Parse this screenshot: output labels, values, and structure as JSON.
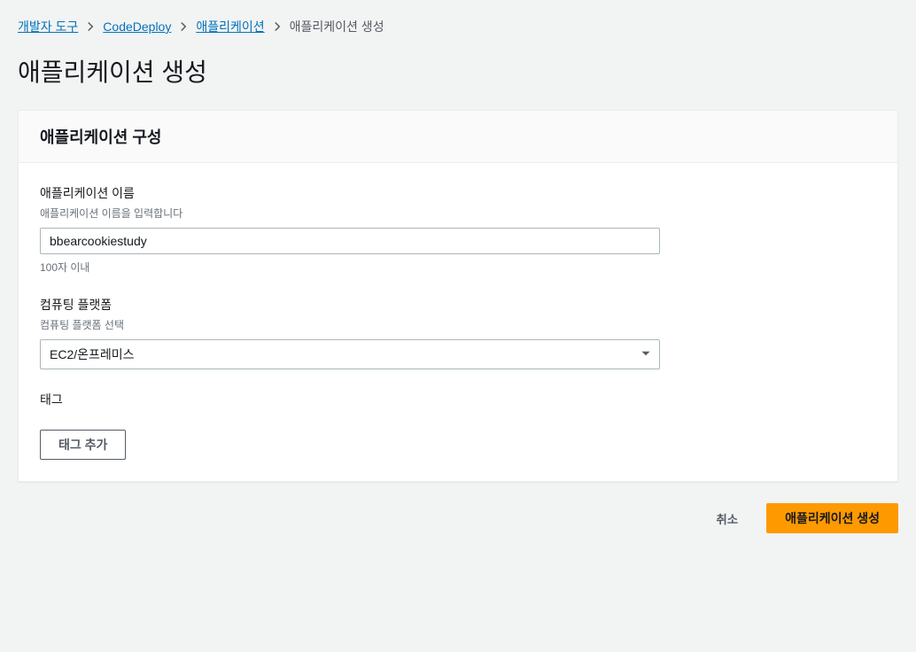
{
  "breadcrumb": {
    "items": [
      {
        "label": "개발자 도구"
      },
      {
        "label": "CodeDeploy"
      },
      {
        "label": "애플리케이션"
      }
    ],
    "current": "애플리케이션 생성"
  },
  "page": {
    "title": "애플리케이션 생성"
  },
  "card": {
    "header": "애플리케이션 구성",
    "app_name": {
      "label": "애플리케이션 이름",
      "hint": "애플리케이션 이름을 입력합니다",
      "value": "bbearcookiestudy",
      "helper": "100자 이내"
    },
    "platform": {
      "label": "컴퓨팅 플랫폼",
      "hint": "컴퓨팅 플랫폼 선택",
      "selected": "EC2/온프레미스"
    },
    "tags": {
      "label": "태그",
      "add_button": "태그 추가"
    }
  },
  "footer": {
    "cancel": "취소",
    "submit": "애플리케이션 생성"
  }
}
